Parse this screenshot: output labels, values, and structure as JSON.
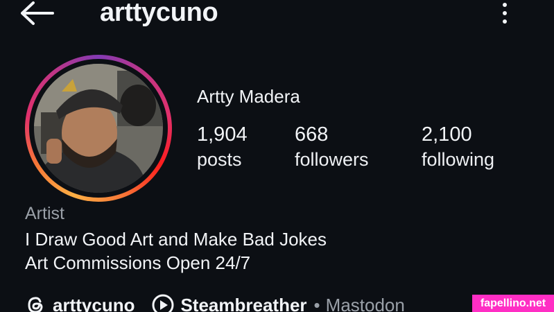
{
  "header": {
    "back_icon": "arrow-left-icon",
    "username": "arttycuno",
    "menu_icon": "more-vertical-icon"
  },
  "profile": {
    "display_name": "Artty Madera",
    "story_ring_colors": [
      "#fcaf45",
      "#f77737",
      "#e1306c",
      "#c13584",
      "#833ab4"
    ],
    "stats": [
      {
        "value": "1,904",
        "label": "posts"
      },
      {
        "value": "668",
        "label": "followers"
      },
      {
        "value": "2,100",
        "label": "following"
      }
    ],
    "category": "Artist",
    "bio_lines": [
      "I Draw Good Art and Make Bad Jokes",
      "Art Commissions Open 24/7"
    ]
  },
  "links": {
    "threads": {
      "icon": "threads-icon",
      "label": "arttycuno"
    },
    "external": {
      "icon": "play-circle-icon",
      "label": "Steambreather",
      "separator": "•",
      "secondary": "Mastodon"
    }
  },
  "watermark": {
    "text": "fapellino.net",
    "color": "#ff2ec4"
  }
}
